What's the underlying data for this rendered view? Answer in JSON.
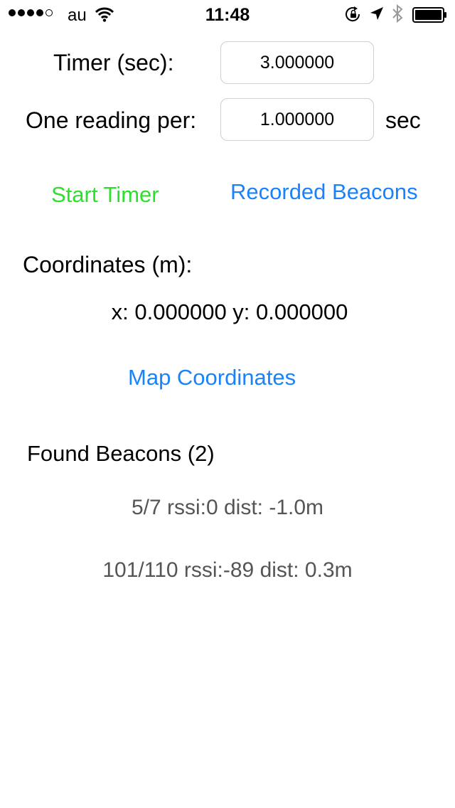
{
  "status_bar": {
    "carrier": "au",
    "time": "11:48",
    "signal_bars_filled": 4,
    "signal_bars_total": 5,
    "icons": [
      "wifi-icon",
      "rotation-lock-icon",
      "location-arrow-icon",
      "bluetooth-icon",
      "battery-icon"
    ]
  },
  "timer": {
    "label": "Timer (sec):",
    "value": "3.000000"
  },
  "reading": {
    "label": "One reading per:",
    "value": "1.000000",
    "unit": "sec"
  },
  "actions": {
    "start_timer": "Start Timer",
    "recorded_beacons": "Recorded Beacons",
    "map_coordinates": "Map Coordinates"
  },
  "coordinates": {
    "label": "Coordinates (m):",
    "text": "x: 0.000000  y: 0.000000"
  },
  "found_beacons": {
    "label": "Found Beacons (2)",
    "items": [
      {
        "text": "5/7 rssi:0 dist: -1.0m"
      },
      {
        "text": "101/110 rssi:-89 dist: 0.3m"
      }
    ]
  },
  "colors": {
    "accent_blue": "#1a82fb",
    "start_green": "#2ce02c",
    "beacon_gray": "#555555"
  }
}
